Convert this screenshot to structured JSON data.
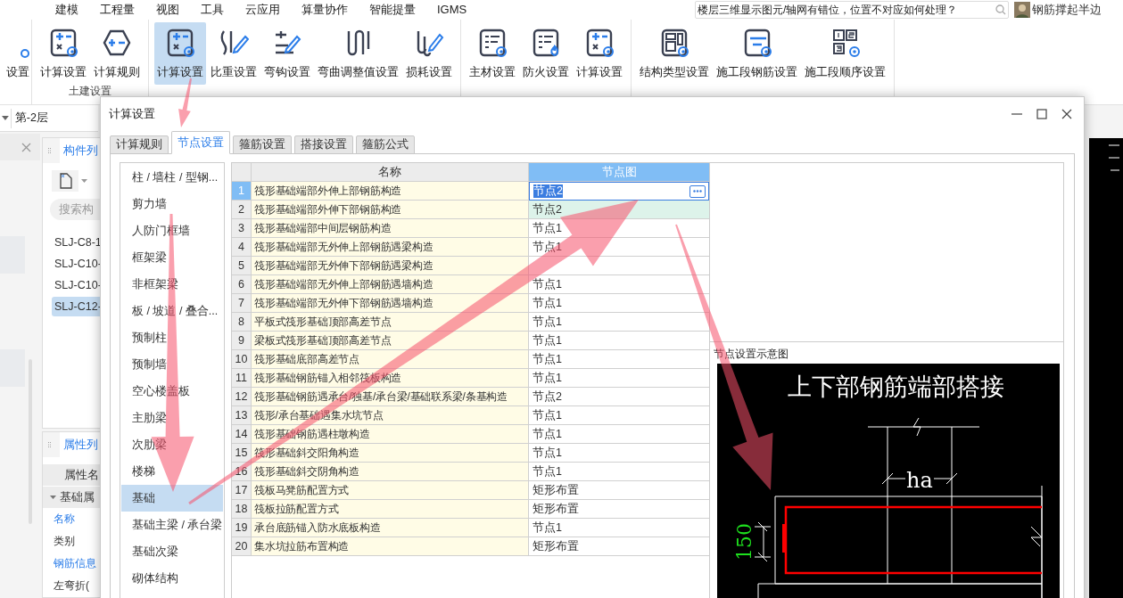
{
  "menu": [
    "建模",
    "工程量",
    "视图",
    "工具",
    "云应用",
    "算量协作",
    "智能提量",
    "IGMS"
  ],
  "help_search": {
    "value": "楼层三维显示图元/轴网有错位，位置不对应如何处理？"
  },
  "user": {
    "name": "钢筋撑起半边"
  },
  "ribbon": {
    "partial_button": {
      "label": "设置",
      "kind": "calc"
    },
    "groups": [
      {
        "label": "土建设置",
        "buttons": [
          {
            "label": "计算设置",
            "kind": "calc",
            "selected": false
          },
          {
            "label": "计算规则",
            "kind": "rule",
            "selected": false
          }
        ]
      },
      {
        "buttons": [
          {
            "label": "计算设置",
            "kind": "calc",
            "selected": true
          },
          {
            "label": "比重设置",
            "kind": "density",
            "selected": false
          },
          {
            "label": "弯钩设置",
            "kind": "hook",
            "selected": false
          },
          {
            "label": "弯曲调整值设置",
            "kind": "bend",
            "selected": false
          },
          {
            "label": "损耗设置",
            "kind": "loss",
            "selected": false
          }
        ]
      },
      {
        "buttons": [
          {
            "label": "主材设置",
            "kind": "material",
            "selected": false
          },
          {
            "label": "防火设置",
            "kind": "fire",
            "selected": false
          },
          {
            "label": "计算设置",
            "kind": "calc",
            "selected": false
          }
        ]
      },
      {
        "buttons": [
          {
            "label": "结构类型设置",
            "kind": "structure",
            "selected": false
          },
          {
            "label": "施工段钢筋设置",
            "kind": "segment",
            "selected": false
          },
          {
            "label": "施工段顺序设置",
            "kind": "order",
            "selected": false
          }
        ]
      }
    ]
  },
  "floor": {
    "value": "第-2层"
  },
  "component_panel": {
    "tab": "构件列",
    "search": {
      "placeholder": "搜索构"
    },
    "items": [
      {
        "label": "SLJ-C8-1",
        "selected": false
      },
      {
        "label": "SLJ-C10-",
        "selected": false
      },
      {
        "label": "SLJ-C10-",
        "selected": false
      },
      {
        "label": "SLJ-C12-",
        "selected": true
      }
    ]
  },
  "property_panel": {
    "tab": "属性列",
    "column": "属性名",
    "group": "基础属",
    "rows": [
      {
        "label": "名称",
        "linked": true
      },
      {
        "label": "类别",
        "linked": false
      },
      {
        "label": "钢筋信息",
        "linked": true
      },
      {
        "label": "左弯折(",
        "linked": false
      }
    ]
  },
  "dialog": {
    "title": "计算设置",
    "tabs": [
      {
        "label": "计算规则",
        "selected": false
      },
      {
        "label": "节点设置",
        "selected": true
      },
      {
        "label": "箍筋设置",
        "selected": false
      },
      {
        "label": "搭接设置",
        "selected": false
      },
      {
        "label": "箍筋公式",
        "selected": false
      }
    ],
    "categories": [
      {
        "label": "柱 / 墙柱 / 型钢...",
        "selected": false
      },
      {
        "label": "剪力墙",
        "selected": false
      },
      {
        "label": "人防门框墙",
        "selected": false
      },
      {
        "label": "框架梁",
        "selected": false
      },
      {
        "label": "非框架梁",
        "selected": false
      },
      {
        "label": "板 / 坡道 / 叠合...",
        "selected": false
      },
      {
        "label": "预制柱",
        "selected": false
      },
      {
        "label": "预制墙",
        "selected": false
      },
      {
        "label": "空心楼盖板",
        "selected": false
      },
      {
        "label": "主肋梁",
        "selected": false
      },
      {
        "label": "次肋梁",
        "selected": false
      },
      {
        "label": "楼梯",
        "selected": false
      },
      {
        "label": "基础",
        "selected": true
      },
      {
        "label": "基础主梁 / 承台梁",
        "selected": false
      },
      {
        "label": "基础次梁",
        "selected": false
      },
      {
        "label": "砌体结构",
        "selected": false
      }
    ],
    "table": {
      "columns": [
        "名称",
        "节点图"
      ],
      "rows": [
        {
          "number": "1",
          "name": "筏形基础端部外伸上部钢筋构造",
          "node": "节点2",
          "selected": true,
          "highlighted": false
        },
        {
          "number": "2",
          "name": "筏形基础端部外伸下部钢筋构造",
          "node": "节点2",
          "selected": false,
          "highlighted": true
        },
        {
          "number": "3",
          "name": "筏形基础端部中间层钢筋构造",
          "node": "节点1",
          "selected": false,
          "highlighted": false
        },
        {
          "number": "4",
          "name": "筏形基础端部无外伸上部钢筋遇梁构造",
          "node": "节点1",
          "selected": false,
          "highlighted": false
        },
        {
          "number": "5",
          "name": "筏形基础端部无外伸下部钢筋遇梁构造",
          "selected": false,
          "highlighted": false
        },
        {
          "number": "6",
          "name": "筏形基础端部无外伸上部钢筋遇墙构造",
          "node": "节点1",
          "selected": false,
          "highlighted": false
        },
        {
          "number": "7",
          "name": "筏形基础端部无外伸下部钢筋遇墙构造",
          "node": "节点1",
          "selected": false,
          "highlighted": false
        },
        {
          "number": "8",
          "name": "平板式筏形基础顶部高差节点",
          "node": "节点1",
          "selected": false,
          "highlighted": false
        },
        {
          "number": "9",
          "name": "梁板式筏形基础顶部高差节点",
          "node": "节点1",
          "selected": false,
          "highlighted": false
        },
        {
          "number": "10",
          "name": "筏形基础底部高差节点",
          "node": "节点1",
          "selected": false,
          "highlighted": false
        },
        {
          "number": "11",
          "name": "筏形基础钢筋锚入相邻筏板构造",
          "node": "节点1",
          "selected": false,
          "highlighted": false
        },
        {
          "number": "12",
          "name": "筏形基础钢筋遇承台/独基/承台梁/基础联系梁/条基构造",
          "node": "节点2",
          "selected": false,
          "highlighted": false
        },
        {
          "number": "13",
          "name": "筏形/承台基础遇集水坑节点",
          "node": "节点1",
          "selected": false,
          "highlighted": false
        },
        {
          "number": "14",
          "name": "筏形基础钢筋遇柱墩构造",
          "node": "节点1",
          "selected": false,
          "highlighted": false
        },
        {
          "number": "15",
          "name": "筏形基础斜交阳角构造",
          "node": "节点1",
          "selected": false,
          "highlighted": false
        },
        {
          "number": "16",
          "name": "筏形基础斜交阴角构造",
          "node": "节点1",
          "selected": false,
          "highlighted": false
        },
        {
          "number": "17",
          "name": "筏板马凳筋配置方式",
          "node": "矩形布置",
          "selected": false,
          "highlighted": false
        },
        {
          "number": "18",
          "name": "筏板拉筋配置方式",
          "node": "矩形布置",
          "selected": false,
          "highlighted": false
        },
        {
          "number": "19",
          "name": "承台底筋锚入防水底板构造",
          "node": "节点1",
          "selected": false,
          "highlighted": false
        },
        {
          "number": "20",
          "name": "集水坑拉筋布置构造",
          "node": "矩形布置",
          "selected": false,
          "highlighted": false
        }
      ]
    },
    "diagram": {
      "label": "节点设置示意图",
      "title": "上下部钢筋端部搭接",
      "dimension_width": "ha",
      "dimension_cover": "150"
    }
  }
}
